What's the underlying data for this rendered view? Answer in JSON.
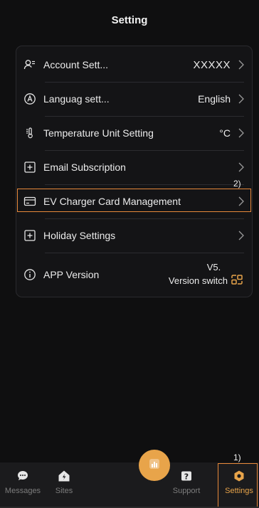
{
  "header": {
    "title": "Setting"
  },
  "settings": {
    "account": {
      "label": "Account Sett...",
      "value": "XXXXX",
      "icon": "user-list-icon"
    },
    "language": {
      "label": "Languag sett...",
      "value": "English",
      "icon": "language-a-icon"
    },
    "temperature": {
      "label": "Temperature Unit Setting",
      "value": "°C",
      "icon": "thermometer-icon"
    },
    "email": {
      "label": "Email Subscription",
      "icon": "plus-box-icon"
    },
    "ev_card": {
      "label": "EV Charger Card Management",
      "icon": "card-icon"
    },
    "holiday": {
      "label": "Holiday Settings",
      "icon": "plus-box-icon"
    },
    "app_version": {
      "label": "APP Version",
      "version": "V5.",
      "switch_label": "Version switch",
      "icon": "info-icon"
    }
  },
  "annotations": {
    "step1": "1)",
    "step2": "2)"
  },
  "bottom_nav": {
    "messages": "Messages",
    "sites": "Sites",
    "support": "Support",
    "settings": "Settings"
  },
  "colors": {
    "accent": "#e8893a",
    "center_button": "#e8a44a",
    "background": "#0f0f10"
  }
}
